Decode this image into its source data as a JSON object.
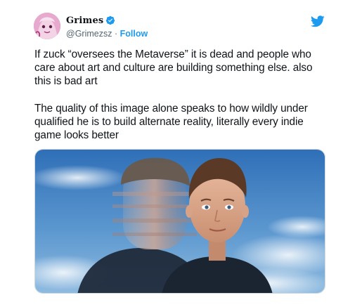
{
  "tweet": {
    "author": {
      "display_name": "Grimes",
      "handle": "@Grimezsz",
      "separator": "·",
      "follow_label": "Follow",
      "verified": true
    },
    "paragraphs": [
      "If zuck “oversees the Metaverse” it is dead and people who care about art and culture are building something else. also this is bad art",
      "The quality of this image alone speaks to how wildly under qualified he is to build alternate reality, literally every indie game looks better"
    ],
    "media": {
      "description_icon": "photo"
    },
    "brand_icon": "twitter-bird-icon"
  },
  "colors": {
    "accent": "#1d9bf0",
    "text": "#0f1419",
    "muted": "#536471"
  }
}
